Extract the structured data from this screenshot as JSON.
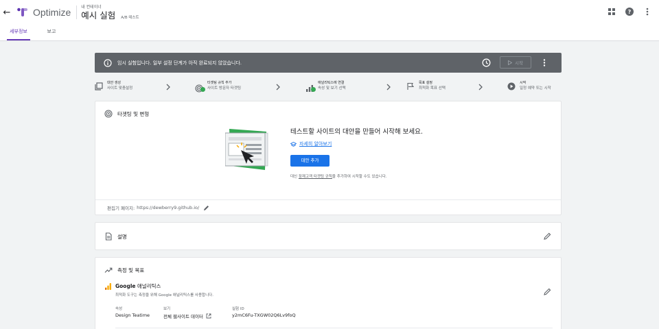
{
  "header": {
    "app_name": "Optimize",
    "container_name": "내 컨테이너",
    "experiment_title": "예시 실험",
    "experiment_type": "A/B 테스트"
  },
  "tabs": [
    {
      "label": "세부정보",
      "active": true
    },
    {
      "label": "보고",
      "active": false
    }
  ],
  "banner": {
    "message": "임시 실험입니다. 일부 설정 단계가 아직 완료되지 않았습니다.",
    "start_label": "시작"
  },
  "steps": [
    {
      "title": "대안 생성",
      "subtitle": "사이트 맞춤설정",
      "icon": "variants-icon",
      "done": false
    },
    {
      "title": "타겟팅 규칙 추가",
      "subtitle": "사이트 방문자 타겟팅",
      "icon": "targeting-icon",
      "done": true
    },
    {
      "title": "애널리틱스에 연결",
      "subtitle": "속성 및 보기 선택",
      "icon": "analytics-icon",
      "done": true
    },
    {
      "title": "목표 설정",
      "subtitle": "최적화 목표 선택",
      "icon": "flag-icon",
      "done": false
    },
    {
      "title": "시작",
      "subtitle": "일정 예약 또는 시작",
      "icon": "play-circle-icon",
      "done": false
    }
  ],
  "targeting": {
    "title": "타겟팅 및 변형",
    "heading": "테스트할 사이트의 대안을 만들어 시작해 보세요.",
    "learn_more": "자세히 알아보기",
    "add_button": "대안 추가",
    "alt_prefix": "대신",
    "alt_link": "잠재고객 타겟팅 규칙",
    "alt_suffix": "을 추가하여 시작할 수도 있습니다.",
    "editor_label": "편집기 페이지:",
    "editor_url": "https://dewberry9.github.io/"
  },
  "description": {
    "title": "설명"
  },
  "measurement": {
    "title": "측정 및 목표",
    "ga_brand": "Google",
    "ga_name": "애널리틱스",
    "ga_desc": "최적화 도구는 측정을 위해 Google 애널리틱스를 사용합니다.",
    "property_label": "속성",
    "property_value": "Design Teatime",
    "view_label": "보기",
    "view_value": "전체 웹사이트 데이터",
    "experiment_id_label": "실험 ID",
    "experiment_id_value": "y2mC6Fu-TXGW02Q6Lv9foQ"
  },
  "colors": {
    "accent": "#673ab7",
    "primary_button": "#1a73e8",
    "banner_bg": "#5f6368",
    "check_green": "#34a853",
    "analytics_orange": "#f9ab00"
  }
}
